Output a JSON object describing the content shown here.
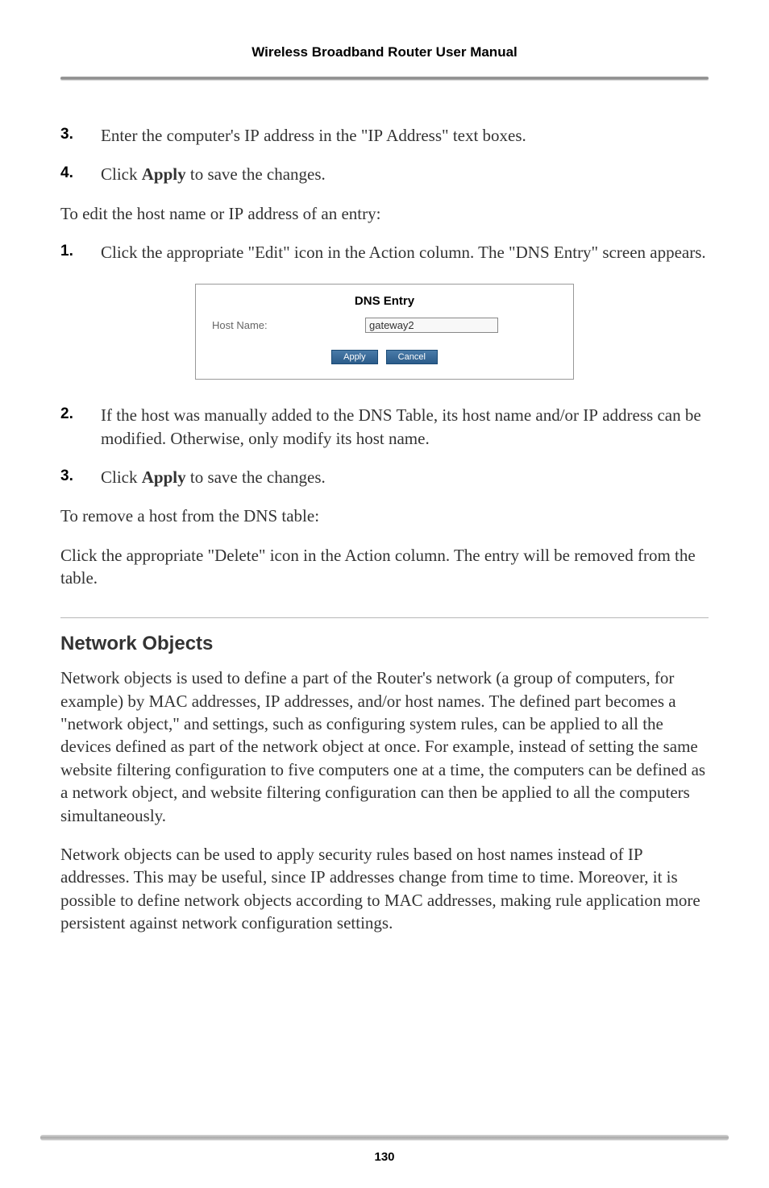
{
  "header": {
    "title": "Wireless Broadband Router User Manual"
  },
  "list1": {
    "item3": {
      "num": "3.",
      "text_a": "Enter the computer's ",
      "ip1": "IP",
      "text_b": " address in the \"",
      "ip2": "IP",
      "text_c": " Address\" text boxes."
    },
    "item4": {
      "num": "4.",
      "text_a": "Click ",
      "bold": "Apply",
      "text_b": " to save the changes."
    }
  },
  "para1": {
    "a": "To edit the host name or ",
    "ip": "IP",
    "b": " address of an entry:"
  },
  "list2": {
    "item1": {
      "num": "1.",
      "text_a": "Click the appropriate \"Edit\" icon in the Action column. The \"",
      "dns": "DNS",
      "text_b": " Entry\" screen appears."
    }
  },
  "screenshot": {
    "title": "DNS Entry",
    "label": "Host Name:",
    "value": "gateway2",
    "apply": "Apply",
    "cancel": "Cancel"
  },
  "list3": {
    "item2": {
      "num": "2.",
      "text_a": "If the host was manually added to the ",
      "dns": "DNS",
      "text_b": " Table, its host name and/or ",
      "ip": "IP",
      "text_c": " address can be modified. Otherwise, only modify its host name."
    },
    "item3": {
      "num": "3.",
      "text_a": "Click ",
      "bold": "Apply",
      "text_b": " to save the changes."
    }
  },
  "para2": {
    "a": "To remove a host from the ",
    "dns": "DNS",
    "b": " table:"
  },
  "para3": "Click the appropriate \"Delete\" icon in the Action column. The entry will be removed from the table.",
  "section": {
    "heading": "Network Objects",
    "p1": {
      "a": "Network objects is used to define a part of the Router's network (a group of computers, for example) by ",
      "mac": "MAC",
      "b": " addresses, ",
      "ip": "IP",
      "c": " addresses, and/or host names. The defined part becomes a \"network object,\" and settings, such as configuring system rules, can be applied to all the devices defined as part of the network object at once. For example, instead of setting the same website filtering configuration to five computers one at a time, the computers can be defined as a network object, and website filtering configuration can then be applied to all the computers simultaneously."
    },
    "p2": {
      "a": "Network objects can be used to apply security rules based on host names instead of ",
      "ip1": "IP",
      "b": " addresses. This may be useful, since ",
      "ip2": "IP",
      "c": " addresses change from time to time. Moreover, it is possible to define network objects according to ",
      "mac": "MAC",
      "d": " addresses, making rule application more persistent against network configuration settings."
    }
  },
  "footer": {
    "pagenum": "130"
  }
}
